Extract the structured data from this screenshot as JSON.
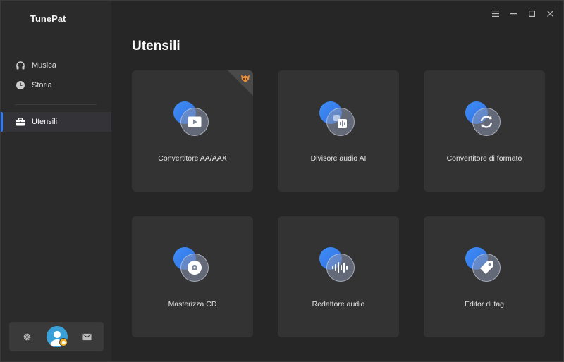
{
  "app": {
    "title": "TunePat"
  },
  "sidebar": {
    "items": [
      {
        "label": "Musica",
        "icon": "headphones-icon"
      },
      {
        "label": "Storia",
        "icon": "clock-icon"
      },
      {
        "label": "Utensili",
        "icon": "toolbox-icon",
        "active": true
      }
    ],
    "bottom": {
      "settings_icon": "gear-icon",
      "avatar_icon": "user-avatar",
      "mail_icon": "mail-icon"
    }
  },
  "main": {
    "title": "Utensili",
    "tools": [
      {
        "label": "Convertitore AA/AAX",
        "icon": "play-icon",
        "badge": "fox-badge-icon"
      },
      {
        "label": "Divisore audio AI",
        "icon": "audio-split-icon"
      },
      {
        "label": "Convertitore di formato",
        "icon": "refresh-icon"
      },
      {
        "label": "Masterizza CD",
        "icon": "disc-icon"
      },
      {
        "label": "Redattore audio",
        "icon": "waveform-icon"
      },
      {
        "label": "Editor di tag",
        "icon": "tag-icon"
      }
    ]
  },
  "colors": {
    "accent": "#2e7cf6",
    "background": "#262626",
    "sidebar": "#2b2b2b",
    "card": "#333333"
  }
}
